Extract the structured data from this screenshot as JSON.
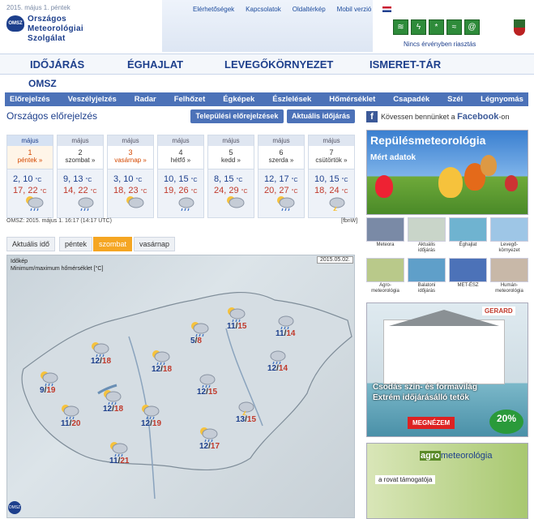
{
  "header": {
    "date": "2015. május 1. péntek",
    "links": [
      "Elérhetőségek",
      "Kapcsolatok",
      "Oldaltérkép",
      "Mobil verzió"
    ],
    "logo_text": "OMSZ",
    "org_name": [
      "Országos",
      "Meteorológiai",
      "Szolgálat"
    ],
    "warning_text": "Nincs érvényben riasztás",
    "warning_icons": [
      "wind-icon",
      "thunder-icon",
      "snow-icon",
      "fog-icon",
      "ice-icon"
    ]
  },
  "main_nav": [
    "IDŐJÁRÁS",
    "ÉGHAJLAT",
    "LEVEGŐKÖRNYEZET",
    "ISMERET-TÁR"
  ],
  "section_label": "OMSZ",
  "sub_nav": [
    "Előrejelzés",
    "Veszélyjelzés",
    "Radar",
    "Felhőzet",
    "Égképek",
    "Észlelések",
    "Hőmérséklet",
    "Csapadék",
    "Szél",
    "Légnyomás"
  ],
  "page_title": "Országos előrejelzés",
  "buttons": {
    "local": "Települési előrejelzések",
    "current": "Aktuális időjárás"
  },
  "facebook": {
    "prefix": "Kövessen bennünket a ",
    "brand": "Facebook",
    "suffix": "-on"
  },
  "forecast": [
    {
      "month": "május",
      "num": "1",
      "day": "péntek »",
      "min": "2, 10",
      "max": "17, 22",
      "unit": "°C",
      "weekend": true,
      "active": true,
      "icon": "partly-cloudy-rain-icon"
    },
    {
      "month": "május",
      "num": "2",
      "day": "szombat »",
      "min": "9, 13",
      "max": "14, 22",
      "unit": "°C",
      "weekend": false,
      "active": false,
      "icon": "rain-icon"
    },
    {
      "month": "május",
      "num": "3",
      "day": "vasárnap »",
      "min": "3, 10",
      "max": "18, 23",
      "unit": "°C",
      "weekend": true,
      "active": false,
      "icon": "partly-cloudy-icon"
    },
    {
      "month": "május",
      "num": "4",
      "day": "hétfő »",
      "min": "10, 15",
      "max": "19, 26",
      "unit": "°C",
      "weekend": false,
      "active": false,
      "icon": "rain-icon"
    },
    {
      "month": "május",
      "num": "5",
      "day": "kedd »",
      "min": "8, 15",
      "max": "24, 29",
      "unit": "°C",
      "weekend": false,
      "active": false,
      "icon": "partly-cloudy-icon"
    },
    {
      "month": "május",
      "num": "6",
      "day": "szerda »",
      "min": "12, 17",
      "max": "20, 27",
      "unit": "°C",
      "weekend": false,
      "active": false,
      "icon": "partly-cloudy-rain-icon"
    },
    {
      "month": "május",
      "num": "7",
      "day": "csütörtök »",
      "min": "10, 15",
      "max": "18, 24",
      "unit": "°C",
      "weekend": false,
      "active": false,
      "icon": "thunder-cloud-icon"
    }
  ],
  "forecast_time": "OMSZ: 2015. május 1. 16:17 (14:17 UTC)",
  "fbw": "[fbnW]",
  "tabs": [
    "Aktuális idő",
    "péntek",
    "szombat",
    "vasárnap"
  ],
  "map": {
    "title": "Időkép",
    "subtitle": "Minimum/maximum hőmérséklet [°C]",
    "date": "2015.05.02.",
    "logo": "OMSZ",
    "cities": [
      {
        "min": "11",
        "max": "15",
        "icon": "rain-sun-icon"
      },
      {
        "min": "11",
        "max": "14",
        "icon": "cloud-rain-icon"
      },
      {
        "min": "5",
        "max": "8",
        "icon": "rain-sun-icon"
      },
      {
        "min": "12",
        "max": "18",
        "icon": "rain-sun-icon"
      },
      {
        "min": "12",
        "max": "18",
        "icon": "rain-sun-icon"
      },
      {
        "min": "12",
        "max": "14",
        "icon": "cloud-rain-icon"
      },
      {
        "min": "9",
        "max": "19",
        "icon": "rain-sun-icon"
      },
      {
        "min": "12",
        "max": "15",
        "icon": "cloud-rain-icon"
      },
      {
        "min": "12",
        "max": "18",
        "icon": "rain-sun-icon"
      },
      {
        "min": "11",
        "max": "20",
        "icon": "rain-sun-icon"
      },
      {
        "min": "12",
        "max": "19",
        "icon": "rain-sun-icon"
      },
      {
        "min": "13",
        "max": "15",
        "icon": "thunder-icon"
      },
      {
        "min": "12",
        "max": "17",
        "icon": "rain-sun-icon"
      },
      {
        "min": "11",
        "max": "21",
        "icon": "rain-sun-icon"
      }
    ]
  },
  "aviation": {
    "title": "Repülésmeteorológia",
    "subtitle": "Mért adatok"
  },
  "tiles": [
    [
      "Meteora"
    ],
    [
      "Aktuális",
      "időjárás"
    ],
    [
      "Éghajlat"
    ],
    [
      "Levegő-",
      "környezet"
    ],
    [
      "Agro-",
      "meteorológia"
    ],
    [
      "Balatoni",
      "időjárás"
    ],
    [
      "MET-ÉSZ"
    ],
    [
      "Humán-",
      "meteorológia"
    ]
  ],
  "ad_gerard": {
    "brand": "GERARD",
    "text": [
      "Csodás szín- és formavilág",
      "Extrém időjárásálló tetők"
    ],
    "button": "MEGNÉZEM",
    "percent": "20%"
  },
  "ad_agro": {
    "title_bold": "agro",
    "title_rest": "meteorológia",
    "subtitle": "a rovat támogatója"
  },
  "colors": {
    "nav_blue": "#4c72b8",
    "title_blue": "#1d3f8c",
    "active_tab": "#f5a623",
    "max_red": "#c0392b"
  }
}
